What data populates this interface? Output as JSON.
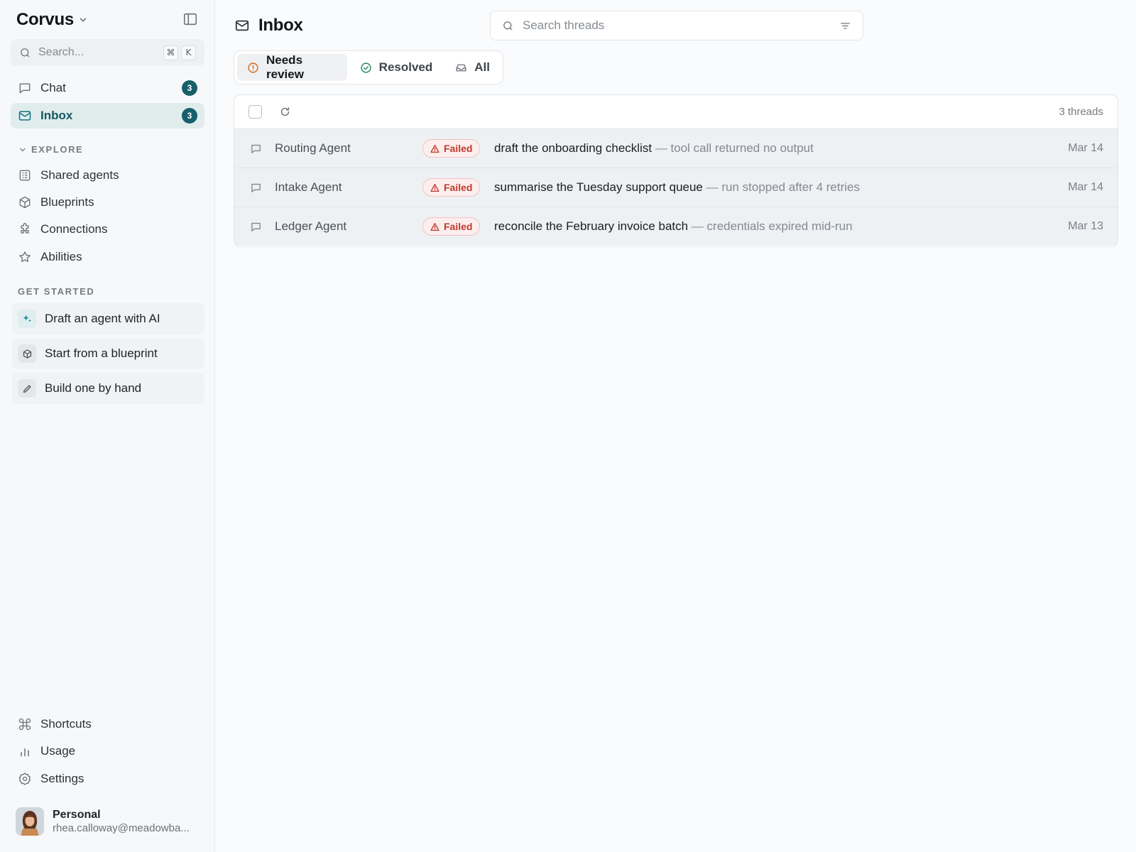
{
  "brand": {
    "name": "Corvus"
  },
  "sidebar": {
    "search": {
      "placeholder": "Search...",
      "kbd1": "⌘",
      "kbd2": "K"
    },
    "primary": [
      {
        "label": "Chat",
        "badge": "3",
        "icon": "chat-icon"
      },
      {
        "label": "Inbox",
        "badge": "3",
        "icon": "mail-icon",
        "active": true
      }
    ],
    "explore": {
      "title": "EXPLORE",
      "items": [
        {
          "label": "Shared agents",
          "icon": "grid-list-icon"
        },
        {
          "label": "Blueprints",
          "icon": "cube-icon"
        },
        {
          "label": "Connections",
          "icon": "puzzle-icon"
        },
        {
          "label": "Abilities",
          "icon": "star-icon"
        }
      ]
    },
    "get_started": {
      "title": "GET STARTED",
      "items": [
        {
          "label": "Draft an agent with AI",
          "icon": "sparkles-icon"
        },
        {
          "label": "Start from a blueprint",
          "icon": "cube-icon"
        },
        {
          "label": "Build one by hand",
          "icon": "pencil-icon"
        }
      ]
    },
    "bottom": [
      {
        "label": "Shortcuts",
        "icon": "command-icon"
      },
      {
        "label": "Usage",
        "icon": "bar-chart-icon"
      },
      {
        "label": "Settings",
        "icon": "gear-icon"
      }
    ],
    "profile": {
      "name": "Personal",
      "email": "rhea.calloway@meadowba..."
    }
  },
  "main": {
    "title": "Inbox",
    "search": {
      "placeholder": "Search threads"
    },
    "tabs": [
      {
        "label": "Needs review",
        "active": true
      },
      {
        "label": "Resolved"
      },
      {
        "label": "All"
      }
    ],
    "thread_count": "3 threads",
    "threads": [
      {
        "agent": "Routing Agent",
        "status": "Failed",
        "title": "draft the onboarding checklist",
        "sep": " — ",
        "detail": "tool call returned no output",
        "date": "Mar 14"
      },
      {
        "agent": "Intake Agent",
        "status": "Failed",
        "title": "summarise the Tuesday support queue",
        "sep": " — ",
        "detail": "run stopped after 4 retries",
        "date": "Mar 14"
      },
      {
        "agent": "Ledger Agent",
        "status": "Failed",
        "title": "reconcile the February invoice batch",
        "sep": " — ",
        "detail": "credentials expired mid-run",
        "date": "Mar 13"
      }
    ]
  },
  "colors": {
    "accent": "#17606b",
    "active_bg": "#e1ecec",
    "failed": "#c0392b",
    "failed_bg": "#fdeeee"
  }
}
